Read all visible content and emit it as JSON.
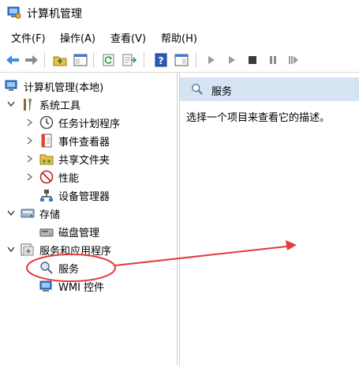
{
  "window": {
    "title": "计算机管理"
  },
  "menu": {
    "file": "文件(F)",
    "action": "操作(A)",
    "view": "查看(V)",
    "help": "帮助(H)"
  },
  "tree": {
    "root": "计算机管理(本地)",
    "system_tools": "系统工具",
    "task_scheduler": "任务计划程序",
    "event_viewer": "事件查看器",
    "shared_folders": "共享文件夹",
    "performance": "性能",
    "device_manager": "设备管理器",
    "storage": "存储",
    "disk_management": "磁盘管理",
    "services_apps": "服务和应用程序",
    "services": "服务",
    "wmi_control": "WMI 控件"
  },
  "right_pane": {
    "header": "服务",
    "description": "选择一个项目来查看它的描述。"
  },
  "colors": {
    "header_bg": "#d6e3f3",
    "annotation": "#e23b3b",
    "accent": "#2b6cb0"
  }
}
